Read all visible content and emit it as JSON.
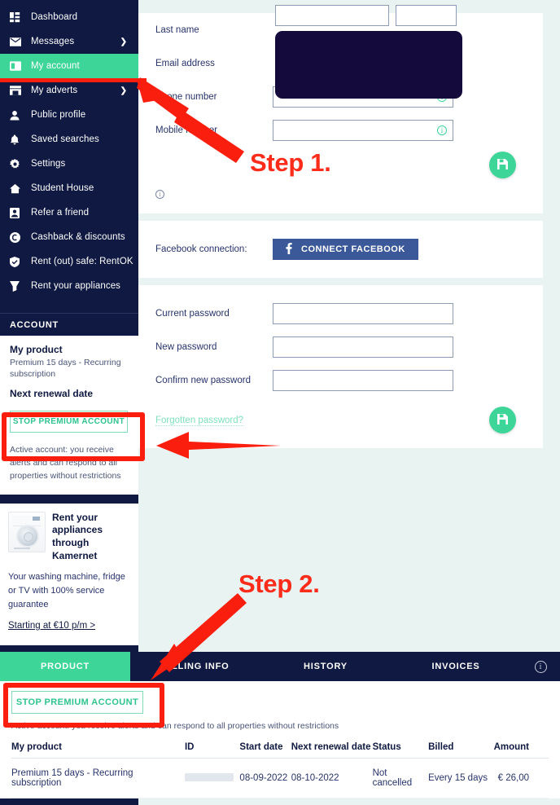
{
  "sidebar": {
    "nav": [
      {
        "label": "Dashboard",
        "icon": "dashboard-grid-icon",
        "caret": false,
        "active": false
      },
      {
        "label": "Messages",
        "icon": "envelope-icon",
        "caret": true,
        "active": false
      },
      {
        "label": "My account",
        "icon": "account-card-icon",
        "caret": false,
        "active": true
      },
      {
        "label": "My adverts",
        "icon": "storefront-icon",
        "caret": true,
        "active": false
      },
      {
        "label": "Public profile",
        "icon": "person-icon",
        "caret": false,
        "active": false
      },
      {
        "label": "Saved searches",
        "icon": "bell-icon",
        "caret": false,
        "active": false
      },
      {
        "label": "Settings",
        "icon": "gear-icon",
        "caret": false,
        "active": false
      },
      {
        "label": "Student House",
        "icon": "home-icon",
        "caret": false,
        "active": false
      },
      {
        "label": "Refer a friend",
        "icon": "id-card-icon",
        "caret": false,
        "active": false
      },
      {
        "label": "Cashback & discounts",
        "icon": "coin-icon",
        "caret": false,
        "active": false
      },
      {
        "label": "Rent (out) safe: RentOK",
        "icon": "shield-icon",
        "caret": false,
        "active": false
      },
      {
        "label": "Rent your appliances",
        "icon": "cart-icon",
        "caret": false,
        "active": false
      }
    ],
    "account": {
      "header": "ACCOUNT",
      "product_label": "My product",
      "product_value": "Premium 15 days - Recurring subscription",
      "renewal_label": "Next renewal date",
      "stop_button": "STOP PREMIUM ACCOUNT",
      "status_note": "Active account: you receive alerts and can respond to all properties without restrictions"
    },
    "promo": {
      "title": "Rent your appliances through Kamernet",
      "body": "Your washing machine, fridge or TV with 100% service guarantee",
      "link": "Starting at €10 p/m >",
      "icon": "washing-machine-icon"
    }
  },
  "form": {
    "fields": [
      {
        "label": "Last name",
        "value": "",
        "placeholder": "",
        "info": false
      },
      {
        "label": "Email address",
        "value": "",
        "placeholder": "",
        "info": false
      },
      {
        "label": "Phone number",
        "value": "",
        "placeholder": "",
        "info": true
      },
      {
        "label": "Mobile number",
        "value": "",
        "placeholder": "",
        "info": true
      }
    ],
    "save_icon": "save-floppy-icon",
    "info_icon": "info-icon"
  },
  "facebook": {
    "label": "Facebook connection:",
    "button": "CONNECT FACEBOOK",
    "icon": "facebook-f-icon",
    "color": "#3b5998"
  },
  "password": {
    "fields": [
      {
        "label": "Current password",
        "value": ""
      },
      {
        "label": "New password",
        "value": ""
      },
      {
        "label": "Confirm new password",
        "value": ""
      }
    ],
    "forgot_link": "Forgotten password?",
    "save_icon": "save-floppy-icon"
  },
  "bottom": {
    "tabs": [
      {
        "label": "PRODUCT",
        "active": true
      },
      {
        "label": "BILLING INFO",
        "active": false
      },
      {
        "label": "HISTORY",
        "active": false
      },
      {
        "label": "INVOICES",
        "active": false
      }
    ],
    "tab_info_icon": "info-icon",
    "stop_button": "STOP PREMIUM ACCOUNT",
    "status_note": "Active account: you receive alerts and can respond to all properties without restrictions",
    "table": {
      "columns": [
        "My product",
        "ID",
        "Start date",
        "Next renewal date",
        "Status",
        "Billed",
        "Amount"
      ],
      "rows": [
        {
          "product": "Premium 15 days - Recurring subscription",
          "id": "",
          "start_date": "08-09-2022",
          "next_renewal_date": "08-10-2022",
          "status": "Not cancelled",
          "billed": "Every 15 days",
          "amount": "€ 26,00"
        }
      ]
    }
  },
  "annotations": {
    "step1": "Step 1.",
    "step2": "Step 2.",
    "color": "#fc2b1a"
  },
  "colors": {
    "navy": "#0f1941",
    "green": "#3dd598",
    "mint_bg": "#e8f3f2",
    "facebook_blue": "#3b5998",
    "annotation_red": "#fc2b1a"
  }
}
